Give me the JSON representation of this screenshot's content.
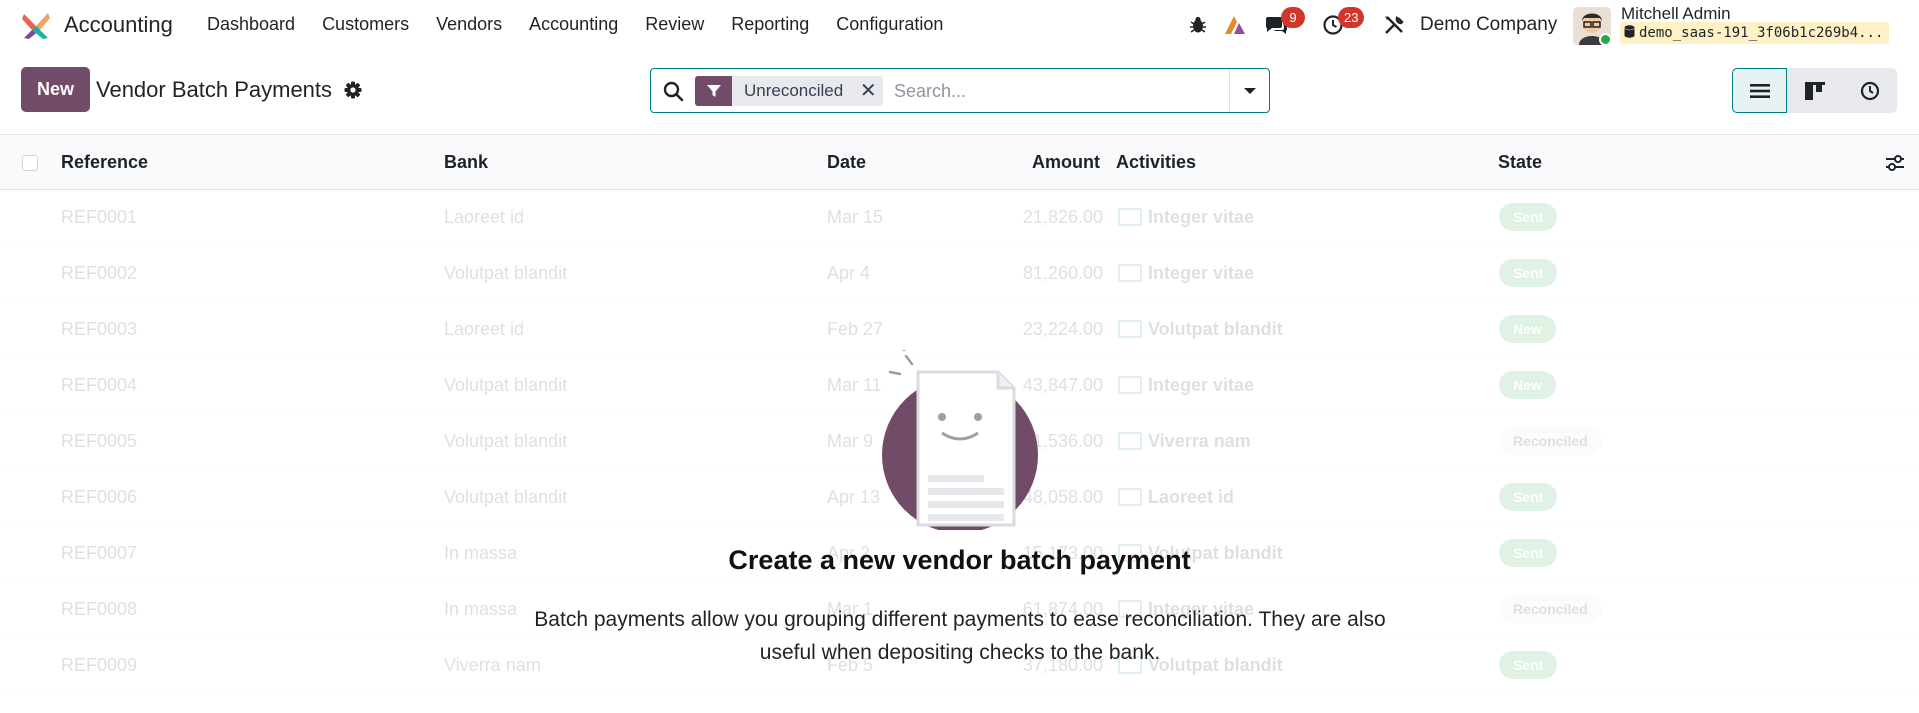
{
  "navbar": {
    "app_name": "Accounting",
    "menu": [
      "Dashboard",
      "Customers",
      "Vendors",
      "Accounting",
      "Review",
      "Reporting",
      "Configuration"
    ],
    "messages_count": "9",
    "activities_count": "23",
    "company": "Demo Company",
    "user_name": "Mitchell Admin",
    "db_name": "demo_saas-191_3f06b1c269b4..."
  },
  "control": {
    "new_label": "New",
    "title": "Vendor Batch Payments",
    "facet_label": "Unreconciled",
    "facet_remove": "✕",
    "search_placeholder": "Search..."
  },
  "list": {
    "columns": [
      "Reference",
      "Bank",
      "Date",
      "Amount",
      "Activities",
      "State"
    ],
    "rows": [
      {
        "ref": "REF0001",
        "bank": "Laoreet id",
        "date": "Mar 15",
        "amount": "21,826.00",
        "activity": "Integer vitae",
        "state": "Sent"
      },
      {
        "ref": "REF0002",
        "bank": "Volutpat blandit",
        "date": "Apr 4",
        "amount": "81,260.00",
        "activity": "Integer vitae",
        "state": "Sent"
      },
      {
        "ref": "REF0003",
        "bank": "Laoreet id",
        "date": "Feb 27",
        "amount": "23,224.00",
        "activity": "Volutpat blandit",
        "state": "New"
      },
      {
        "ref": "REF0004",
        "bank": "Volutpat blandit",
        "date": "Mar 11",
        "amount": "43,847.00",
        "activity": "Integer vitae",
        "state": "New"
      },
      {
        "ref": "REF0005",
        "bank": "Volutpat blandit",
        "date": "Mar 9",
        "amount": "11,536.00",
        "activity": "Viverra nam",
        "state": "Reconciled"
      },
      {
        "ref": "REF0006",
        "bank": "Volutpat blandit",
        "date": "Apr 13",
        "amount": "48,058.00",
        "activity": "Laoreet id",
        "state": "Sent"
      },
      {
        "ref": "REF0007",
        "bank": "In massa",
        "date": "Apr 2",
        "amount": "15,173.00",
        "activity": "Volutpat blandit",
        "state": "Sent"
      },
      {
        "ref": "REF0008",
        "bank": "In massa",
        "date": "Mar 1",
        "amount": "61,874.00",
        "activity": "Integer vitae",
        "state": "Reconciled"
      },
      {
        "ref": "REF0009",
        "bank": "Viverra nam",
        "date": "Feb 5",
        "amount": "37,180.00",
        "activity": "Volutpat blandit",
        "state": "Sent"
      }
    ]
  },
  "helper": {
    "title": "Create a new vendor batch payment",
    "text": "Batch payments allow you grouping different payments to ease reconciliation. They are also useful when depositing checks to the bank."
  },
  "colors": {
    "brand": "#714b67",
    "accent": "#017e84",
    "badge": "#d0362c",
    "success": "#28a745"
  }
}
